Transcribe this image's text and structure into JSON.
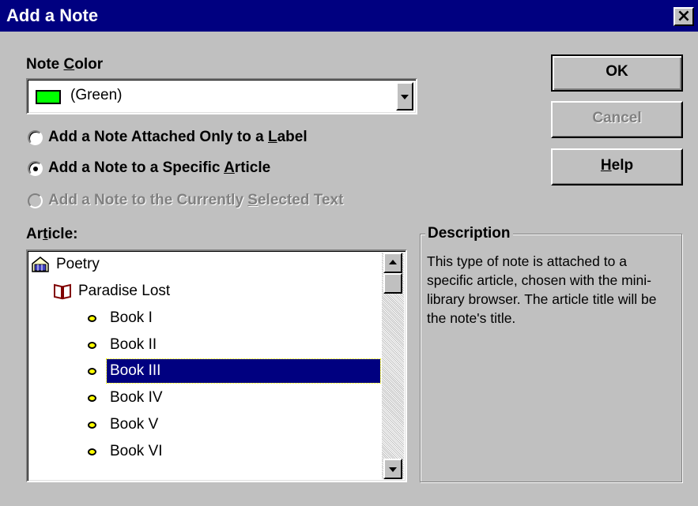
{
  "window": {
    "title": "Add a Note",
    "close_glyph": "×"
  },
  "note_color": {
    "label_prefix": "Note ",
    "label_accel": "C",
    "label_suffix": "olor",
    "value": "(Green)",
    "swatch_color": "#00ff00"
  },
  "radios": [
    {
      "text_pre": "Add a Note Attached Only to a ",
      "accel": "L",
      "text_post": "abel",
      "checked": false,
      "enabled": true
    },
    {
      "text_pre": "Add a Note to a Specific ",
      "accel": "A",
      "text_post": "rticle",
      "checked": true,
      "enabled": true
    },
    {
      "text_pre": "Add a Note to the Currently ",
      "accel": "S",
      "text_post": "elected Text",
      "checked": false,
      "enabled": false
    }
  ],
  "buttons": {
    "ok": "OK",
    "cancel": "Cancel",
    "help_accel": "H",
    "help_rest": "elp"
  },
  "article": {
    "label_pre": "Ar",
    "label_accel": "t",
    "label_post": "icle:",
    "items": [
      "Poetry",
      "Paradise Lost",
      "Book I",
      "Book II",
      "Book III",
      "Book IV",
      "Book V",
      "Book VI"
    ],
    "selected": "Book III"
  },
  "description": {
    "legend": "Description",
    "text": "This type of note is attached to a specific article, chosen with the mini-library browser. The article title will be the note's title."
  },
  "colors": {
    "titlebar": "#000080",
    "face": "#c0c0c0",
    "selection": "#000080"
  }
}
